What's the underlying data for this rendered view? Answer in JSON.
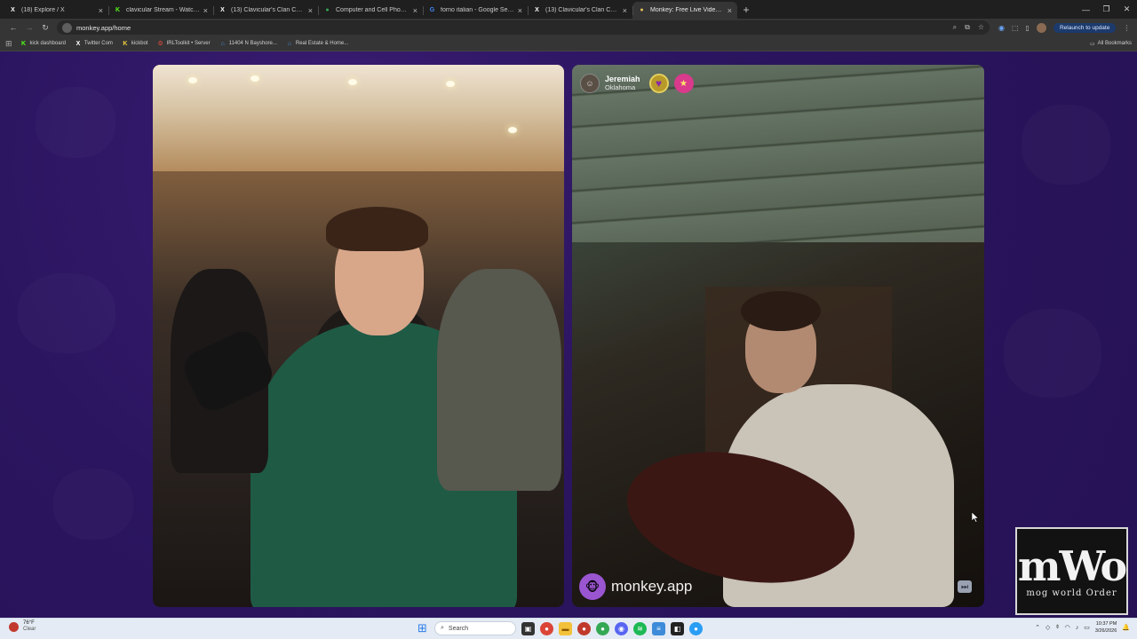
{
  "browser": {
    "tabs": [
      {
        "label": "(18) Explore / X",
        "icon": "x-logo-icon",
        "icon_char": "X",
        "color": "#ffffff"
      },
      {
        "label": "clavicular Stream - Watch Live",
        "icon": "kick-logo-icon",
        "icon_char": "K",
        "color": "#53fc18"
      },
      {
        "label": "(13) Clavicular's Clan Communi",
        "icon": "x-logo-icon",
        "icon_char": "X",
        "color": "#ffffff"
      },
      {
        "label": "Computer and Cell Phone Stor",
        "icon": "map-pin-icon",
        "icon_char": "●",
        "color": "#34a853"
      },
      {
        "label": "forno italian - Google Search",
        "icon": "google-logo-icon",
        "icon_char": "G",
        "color": "#4285f4"
      },
      {
        "label": "(13) Clavicular's Clan Communi",
        "icon": "x-logo-icon",
        "icon_char": "X",
        "color": "#ffffff"
      },
      {
        "label": "Monkey: Free Live Video Ch",
        "icon": "monkey-logo-icon",
        "icon_char": "●",
        "color": "#e6c15a"
      }
    ],
    "new_tab": "+",
    "url": "monkey.app/home",
    "relaunch_label": "Relaunch to update",
    "all_bookmarks": "All Bookmarks",
    "bookmarks": [
      {
        "label": "kick dashboard",
        "icon_char": "K",
        "color": "#53fc18"
      },
      {
        "label": "Twitter Com",
        "icon_char": "X",
        "color": "#ffffff"
      },
      {
        "label": "kickbot",
        "icon_char": "K",
        "color": "#f4d03f"
      },
      {
        "label": "IRLToolkit • Server",
        "icon_char": "⚙",
        "color": "#e74c3c"
      },
      {
        "label": "11404 N Bayshore...",
        "icon_char": "⌂",
        "color": "#4a90e2"
      },
      {
        "label": "Real Estate & Home...",
        "icon_char": "⌂",
        "color": "#4a90e2"
      }
    ]
  },
  "call": {
    "partner": {
      "name": "Jeremiah",
      "location": "Oklahoma"
    },
    "watermark": "monkey.app",
    "overlay_logo": {
      "big": "mWo",
      "small": "mog world Order"
    }
  },
  "taskbar": {
    "weather_temp": "76°F",
    "weather_cond": "Clear",
    "search_label": "Search",
    "time": "10:37 PM",
    "date": "3/26/2026"
  }
}
